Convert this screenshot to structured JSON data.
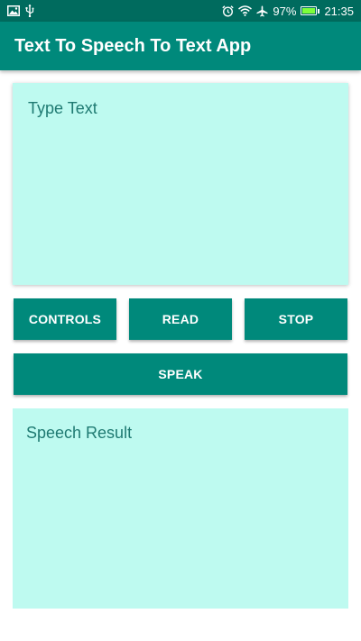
{
  "status_bar": {
    "left_icons": [
      "image-icon",
      "usb-icon"
    ],
    "right_icons": [
      "alarm-icon",
      "wifi-icon",
      "airplane-icon"
    ],
    "battery_percent": "97%",
    "battery_level": 0.97,
    "time": "21:35"
  },
  "app_bar": {
    "title": "Text To Speech To Text App"
  },
  "input_area": {
    "placeholder": "Type Text"
  },
  "buttons": {
    "controls": "CONTROLS",
    "read": "READ",
    "stop": "STOP",
    "speak": "SPEAK"
  },
  "result_area": {
    "placeholder": "Speech Result"
  },
  "colors": {
    "status_bar": "#006b5e",
    "primary": "#00897b",
    "card_background": "#befaf0",
    "hint_text": "#1f7a72"
  }
}
